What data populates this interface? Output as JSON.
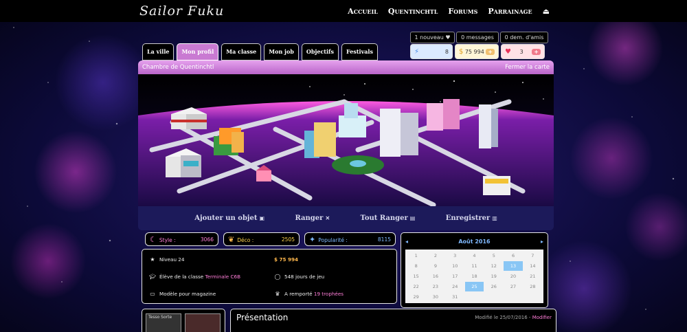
{
  "topbar": {
    "logo": "Sailor Fuku",
    "nav": [
      "Accueil",
      "Quentinchtl",
      "Forums",
      "Parrainage"
    ]
  },
  "notifications": [
    "1 nouveau ♥",
    "0 messages",
    "0 dem. d'amis"
  ],
  "currencies": {
    "blue": "8",
    "gold": "75 994",
    "red": "3"
  },
  "tabs": [
    "La ville",
    "Mon profil",
    "Ma classe",
    "Mon job",
    "Objectifs",
    "Festivals"
  ],
  "room": {
    "title": "Chambre de Quentinchtl",
    "close": "Fermer la carte",
    "actions": [
      "Ajouter un objet",
      "Ranger",
      "Tout Ranger",
      "Enregistrer"
    ]
  },
  "stats": {
    "style_label": "Style :",
    "style": "3066",
    "deco_label": "Déco :",
    "deco": "2505",
    "pop_label": "Popularité :",
    "pop": "8115"
  },
  "info": {
    "niveau": "Niveau 24",
    "money": "$  75 994",
    "eleve_pre": "Élève de la classe ",
    "eleve_class": "Terminale C6B",
    "jours": "548 jours de jeu",
    "modele": "Modèle pour magazine",
    "trophees_pre": "A remporté ",
    "trophees": "19 trophées"
  },
  "calendar": {
    "month": "Août 2016",
    "days": [
      "1",
      "2",
      "3",
      "4",
      "5",
      "6",
      "7",
      "8",
      "9",
      "10",
      "11",
      "12",
      "13",
      "14",
      "15",
      "16",
      "17",
      "18",
      "19",
      "20",
      "21",
      "22",
      "23",
      "24",
      "25",
      "26",
      "27",
      "28",
      "29",
      "30",
      "31"
    ],
    "highlighted": [
      "13",
      "25"
    ]
  },
  "presentation": {
    "title": "Présentation",
    "modified": "Modifié le 25/07/2016 - ",
    "modify": "Modifier"
  },
  "avatars": {
    "label": "Tesso Sorte"
  },
  "colors": {
    "accent": "#c97ad2",
    "pink": "#ff7ed8",
    "gold": "#ffd34d",
    "blue": "#7fb8ff"
  }
}
